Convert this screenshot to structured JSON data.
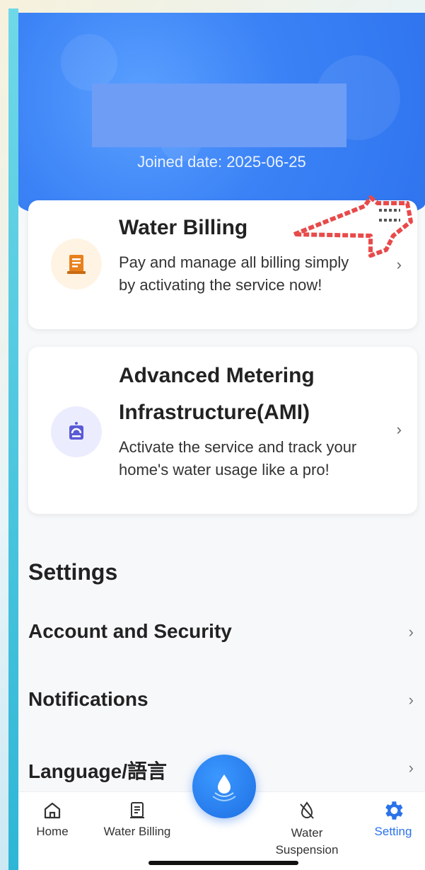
{
  "profile": {
    "joined_date": "Joined date: 2025-06-25"
  },
  "services": [
    {
      "title": "Water Billing",
      "description": "Pay and manage all billing simply by activating the service now!",
      "icon": "bill-icon"
    },
    {
      "title_line1": "Advanced Metering",
      "title_line2": "Infrastructure(AMI)",
      "description": "Activate the service and track your home's water usage like a pro!",
      "icon": "meter-icon"
    }
  ],
  "settings": {
    "title": "Settings",
    "items": [
      {
        "label": "Account and Security"
      },
      {
        "label": "Notifications"
      },
      {
        "label": "Language/語言"
      }
    ]
  },
  "tabs": [
    {
      "label": "Home",
      "icon": "home-icon"
    },
    {
      "label": "Water Billing",
      "icon": "bill-icon"
    },
    {
      "label": "Water\nSuspension",
      "icon": "water-off-icon"
    },
    {
      "label": "Setting",
      "icon": "gear-icon",
      "active": true
    }
  ],
  "colors": {
    "accent": "#2a72ea",
    "hero": "#3b82f6",
    "bill_icon": "#e8811d",
    "meter_icon": "#5b5ad6"
  }
}
